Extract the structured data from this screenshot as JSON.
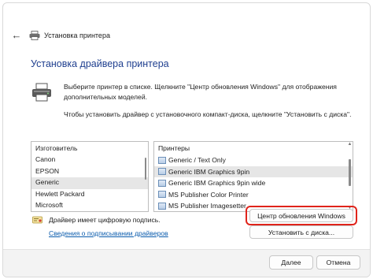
{
  "window": {
    "title": "Установка принтера",
    "back_icon": "back-arrow-icon"
  },
  "main": {
    "heading": "Установка драйвера принтера",
    "description_1": "Выберите принтер в списке. Щелкните \"Центр обновления Windows\" для отображения дополнительных моделей.",
    "description_2": "Чтобы установить драйвер с установочного компакт-диска, щелкните \"Установить с диска\"."
  },
  "manufacturers": {
    "header": "Изготовитель",
    "items": [
      "Canon",
      "EPSON",
      "Generic",
      "Hewlett Packard",
      "Microsoft"
    ],
    "selected": "Generic"
  },
  "printers": {
    "header": "Принтеры",
    "items": [
      "Generic / Text Only",
      "Generic IBM Graphics 9pin",
      "Generic IBM Graphics 9pin wide",
      "MS Publisher Color Printer",
      "MS Publisher Imagesetter"
    ],
    "selected": "Generic IBM Graphics 9pin"
  },
  "signature": {
    "text": "Драйвер имеет цифровую подпись.",
    "link": "Сведения о подписывании драйверов"
  },
  "buttons": {
    "windows_update": "Центр обновления Windows",
    "have_disk": "Установить с диска...",
    "next": "Далее",
    "cancel": "Отмена"
  },
  "colors": {
    "heading": "#1f3f8f",
    "link": "#0b5cad",
    "highlight": "#e0241b"
  }
}
